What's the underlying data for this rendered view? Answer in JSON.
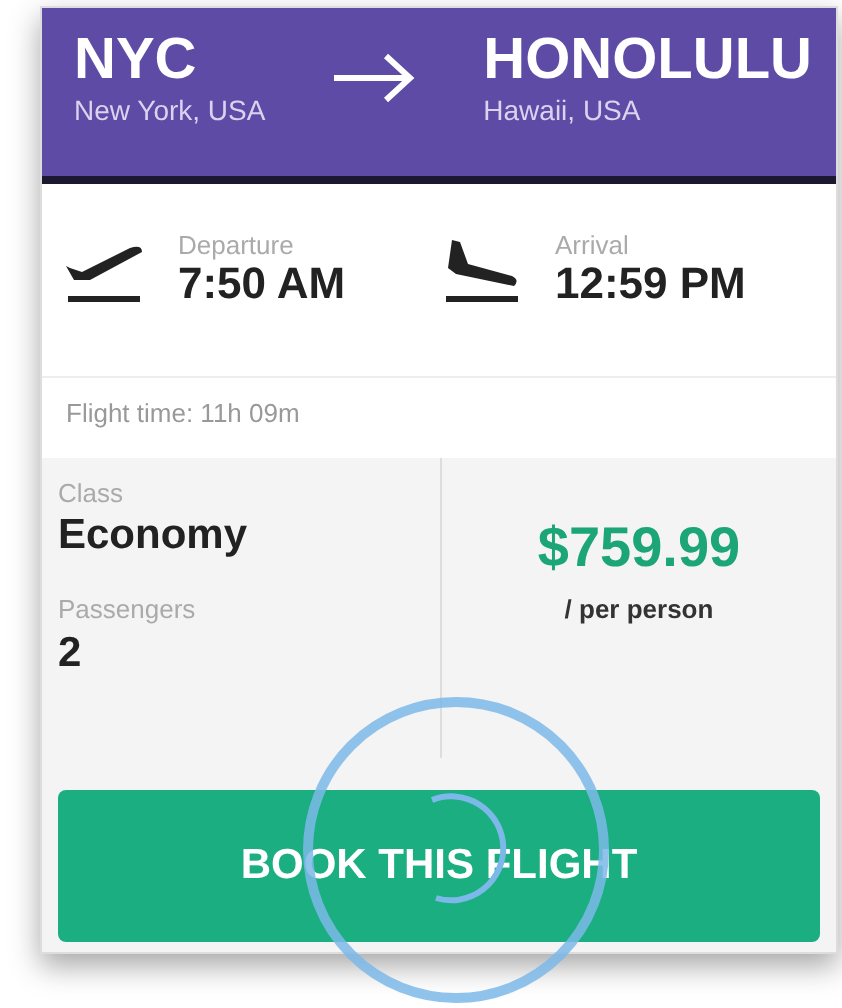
{
  "route": {
    "origin": {
      "code": "NYC",
      "place": "New York, USA"
    },
    "destination": {
      "code": "HONOLULU",
      "place": "Hawaii, USA"
    }
  },
  "times": [
    {
      "kind": "departure",
      "label": "Departure",
      "time": "7:50 AM"
    },
    {
      "kind": "arrival",
      "label": "Arrival",
      "time": "12:59 PM"
    }
  ],
  "flight_time": "Flight time: 11h 09m",
  "details": [
    {
      "label": "Class",
      "value": "Economy"
    },
    {
      "label": "Passengers",
      "value": "2"
    }
  ],
  "price": {
    "amount": "$759.99",
    "unit": "/ per person"
  },
  "book_button": {
    "label": "BOOK THIS FLIGHT",
    "pressed": true
  }
}
